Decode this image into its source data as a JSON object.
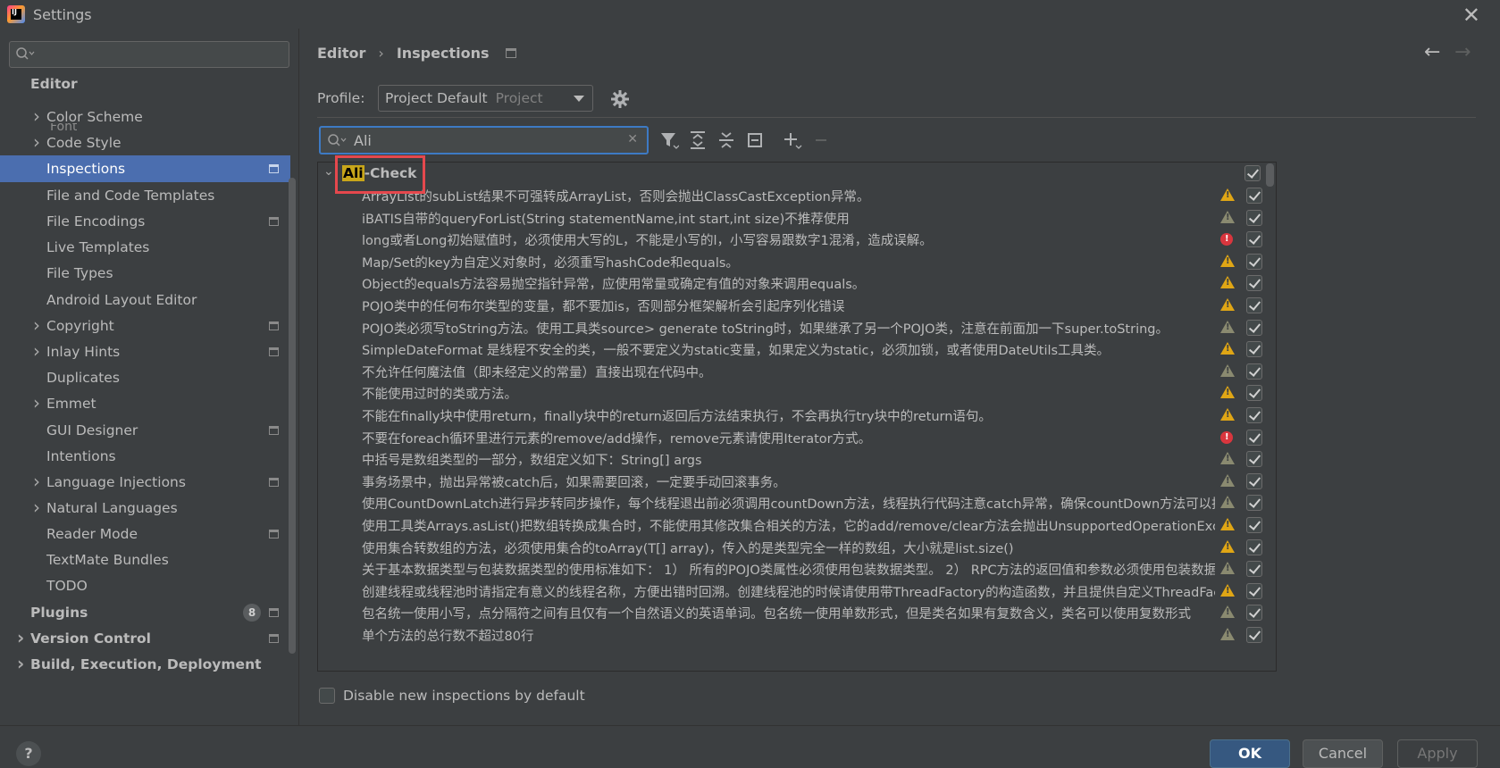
{
  "window": {
    "title": "Settings"
  },
  "sidebar": {
    "search_placeholder": "",
    "partial_item": "Font",
    "items": [
      {
        "label": "Editor",
        "section": true,
        "chevron": false,
        "project": false
      },
      {
        "label": "Color Scheme",
        "chevron": true,
        "project": false
      },
      {
        "label": "Code Style",
        "chevron": true,
        "project": false
      },
      {
        "label": "Inspections",
        "chevron": false,
        "project": true,
        "selected": true
      },
      {
        "label": "File and Code Templates",
        "chevron": false,
        "project": false
      },
      {
        "label": "File Encodings",
        "chevron": false,
        "project": true
      },
      {
        "label": "Live Templates",
        "chevron": false,
        "project": false
      },
      {
        "label": "File Types",
        "chevron": false,
        "project": false
      },
      {
        "label": "Android Layout Editor",
        "chevron": false,
        "project": false
      },
      {
        "label": "Copyright",
        "chevron": true,
        "project": true
      },
      {
        "label": "Inlay Hints",
        "chevron": true,
        "project": true
      },
      {
        "label": "Duplicates",
        "chevron": false,
        "project": false
      },
      {
        "label": "Emmet",
        "chevron": true,
        "project": false
      },
      {
        "label": "GUI Designer",
        "chevron": false,
        "project": true
      },
      {
        "label": "Intentions",
        "chevron": false,
        "project": false
      },
      {
        "label": "Language Injections",
        "chevron": true,
        "project": true
      },
      {
        "label": "Natural Languages",
        "chevron": true,
        "project": false
      },
      {
        "label": "Reader Mode",
        "chevron": false,
        "project": true
      },
      {
        "label": "TextMate Bundles",
        "chevron": false,
        "project": false
      },
      {
        "label": "TODO",
        "chevron": false,
        "project": false
      },
      {
        "label": "Plugins",
        "section": true,
        "chevron": false,
        "project": true,
        "badge": "8"
      },
      {
        "label": "Version Control",
        "section": true,
        "chevron": true,
        "project": true
      },
      {
        "label": "Build, Execution, Deployment",
        "section": true,
        "chevron": true,
        "project": false
      }
    ]
  },
  "breadcrumb": {
    "parent": "Editor",
    "sep": "›",
    "current": "Inspections"
  },
  "profile": {
    "label": "Profile:",
    "name": "Project Default",
    "type": "Project"
  },
  "filter": {
    "value": "Ali"
  },
  "group": {
    "highlight": "Ali",
    "rest": "-Check"
  },
  "inspections": [
    {
      "text": "ArrayList的subList结果不可强转成ArrayList，否则会抛出ClassCastException异常。",
      "severity": "warn"
    },
    {
      "text": "iBATIS自带的queryForList(String statementName,int start,int size)不推荐使用",
      "severity": "weak"
    },
    {
      "text": "long或者Long初始赋值时，必须使用大写的L，不能是小写的l，小写容易跟数字1混淆，造成误解。",
      "severity": "err"
    },
    {
      "text": "Map/Set的key为自定义对象时，必须重写hashCode和equals。",
      "severity": "warn"
    },
    {
      "text": "Object的equals方法容易抛空指针异常，应使用常量或确定有值的对象来调用equals。",
      "severity": "warn"
    },
    {
      "text": "POJO类中的任何布尔类型的变量，都不要加is，否则部分框架解析会引起序列化错误",
      "severity": "warn"
    },
    {
      "text": "POJO类必须写toString方法。使用工具类source> generate toString时，如果继承了另一个POJO类，注意在前面加一下super.toString。",
      "severity": "weak"
    },
    {
      "text": "SimpleDateFormat 是线程不安全的类，一般不要定义为static变量，如果定义为static，必须加锁，或者使用DateUtils工具类。",
      "severity": "warn"
    },
    {
      "text": "不允许任何魔法值（即未经定义的常量）直接出现在代码中。",
      "severity": "weak"
    },
    {
      "text": "不能使用过时的类或方法。",
      "severity": "warn"
    },
    {
      "text": "不能在finally块中使用return，finally块中的return返回后方法结束执行，不会再执行try块中的return语句。",
      "severity": "warn"
    },
    {
      "text": "不要在foreach循环里进行元素的remove/add操作，remove元素请使用Iterator方式。",
      "severity": "err"
    },
    {
      "text": "中括号是数组类型的一部分，数组定义如下：String[] args",
      "severity": "weak"
    },
    {
      "text": "事务场景中，抛出异常被catch后，如果需要回滚，一定要手动回滚事务。",
      "severity": "weak"
    },
    {
      "text": "使用CountDownLatch进行异步转同步操作，每个线程退出前必须调用countDown方法，线程执行代码注意catch异常，确保countDown方法可以执行",
      "severity": "weak"
    },
    {
      "text": "使用工具类Arrays.asList()把数组转换成集合时，不能使用其修改集合相关的方法，它的add/remove/clear方法会抛出UnsupportedOperationException",
      "severity": "warn"
    },
    {
      "text": "使用集合转数组的方法，必须使用集合的toArray(T[] array)，传入的是类型完全一样的数组，大小就是list.size()",
      "severity": "warn"
    },
    {
      "text": "关于基本数据类型与包装数据类型的使用标准如下：   1） 所有的POJO类属性必须使用包装数据类型。   2） RPC方法的返回值和参数必须使用包装数据类型",
      "severity": "weak"
    },
    {
      "text": "创建线程或线程池时请指定有意义的线程名称，方便出错时回溯。创建线程池的时候请使用带ThreadFactory的构造函数，并且提供自定义ThreadFactory实现",
      "severity": "warn"
    },
    {
      "text": "包名统一使用小写，点分隔符之间有且仅有一个自然语义的英语单词。包名统一使用单数形式，但是类名如果有复数含义，类名可以使用复数形式",
      "severity": "weak"
    },
    {
      "text": "单个方法的总行数不超过80行",
      "severity": "weak"
    }
  ],
  "options": {
    "disable_new_label": "Disable new inspections by default",
    "disable_new_checked": false
  },
  "buttons": {
    "help": "?",
    "ok": "OK",
    "cancel": "Cancel",
    "apply": "Apply"
  },
  "icons": {
    "back": "arrow-left-icon",
    "forward": "arrow-right-icon",
    "gear": "gear-icon",
    "filter": "filter-icon",
    "expand": "expand-all-icon",
    "collapse": "collapse-all-icon",
    "reset": "reset-icon",
    "add": "plus-icon",
    "remove": "minus-icon"
  },
  "colors": {
    "selection": "#4b6eaf",
    "accent": "#365880",
    "highlight": "#c8a61a",
    "annotation": "#e5484d",
    "warning": "#e0a615",
    "error": "#d9363e"
  }
}
